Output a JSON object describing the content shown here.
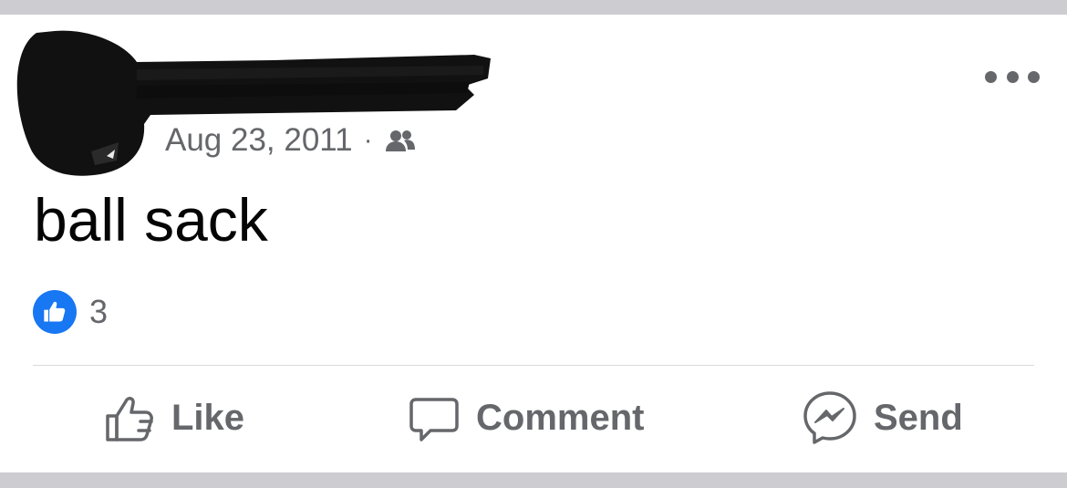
{
  "post": {
    "date": "Aug 23, 2011",
    "separator": "·",
    "audience_icon": "friends-icon",
    "text": "ball sack",
    "reaction_count": "3",
    "reaction_icon": "like-reaction-icon",
    "more_icon": "more-options-icon"
  },
  "actions": {
    "like_label": "Like",
    "comment_label": "Comment",
    "send_label": "Send"
  },
  "colors": {
    "brand_blue": "#1877f2",
    "secondary_text": "#65676b",
    "primary_text": "#050505",
    "page_background": "#ccccd1"
  }
}
